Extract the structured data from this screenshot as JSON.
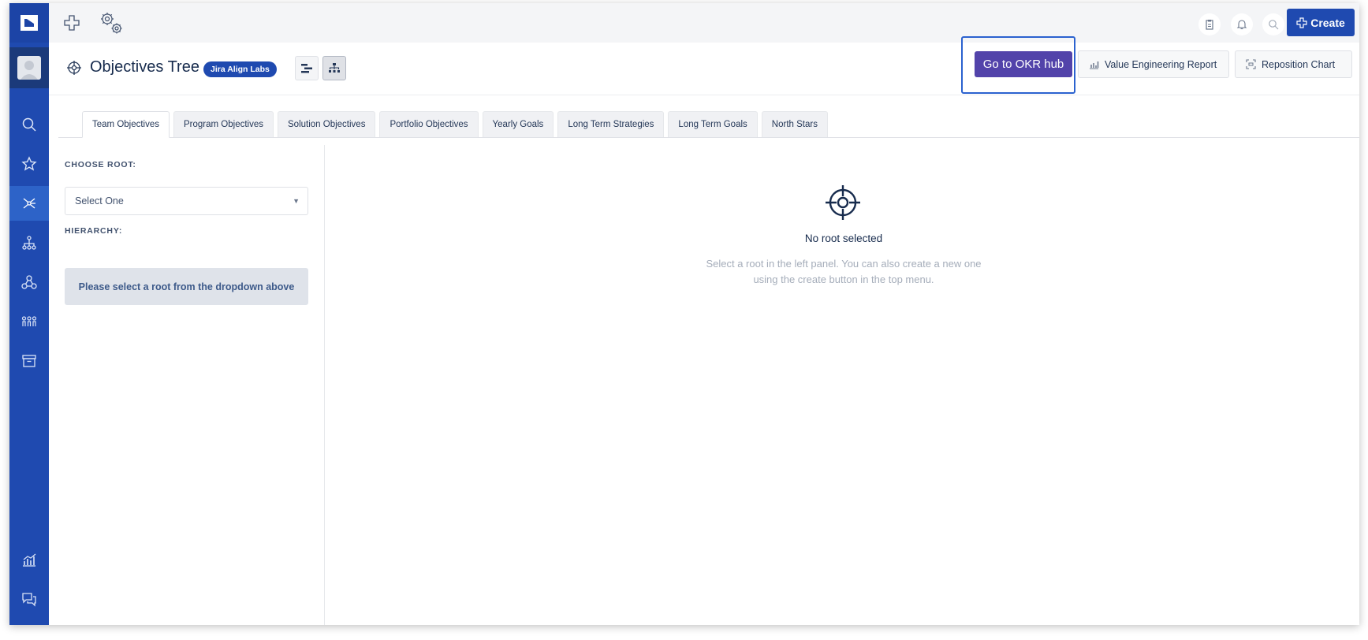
{
  "nav": {
    "items": [
      {
        "name": "search",
        "icon": "search-icon"
      },
      {
        "name": "favorites",
        "icon": "star-icon"
      },
      {
        "name": "objectives",
        "icon": "network-icon",
        "active": true
      },
      {
        "name": "hierarchy",
        "icon": "hierarchy-icon"
      },
      {
        "name": "teams",
        "icon": "connections-icon"
      },
      {
        "name": "people",
        "icon": "people-icon"
      },
      {
        "name": "archive",
        "icon": "archive-icon"
      },
      {
        "name": "reports",
        "icon": "chart-icon"
      },
      {
        "name": "feedback",
        "icon": "chat-icon"
      }
    ]
  },
  "topbar": {
    "create_label": "Create"
  },
  "header": {
    "title": "Objectives Tree",
    "badge": "Jira Align Labs",
    "okr_button": "Go to OKR hub",
    "value_report_button": "Value Engineering Report",
    "reposition_button": "Reposition Chart"
  },
  "tabs": [
    {
      "label": "Team Objectives",
      "active": true
    },
    {
      "label": "Program Objectives"
    },
    {
      "label": "Solution Objectives"
    },
    {
      "label": "Portfolio Objectives"
    },
    {
      "label": "Yearly Goals"
    },
    {
      "label": "Long Term Strategies"
    },
    {
      "label": "Long Term Goals"
    },
    {
      "label": "North Stars"
    }
  ],
  "left_panel": {
    "choose_root_label": "CHOOSE ROOT:",
    "select_value": "Select One",
    "hierarchy_label": "HIERARCHY:",
    "notice": "Please select a root from the dropdown above"
  },
  "empty_state": {
    "title": "No root selected",
    "description_line1": "Select a root in the left panel. You can also create a new one",
    "description_line2": "using the create button in the top menu."
  },
  "colors": {
    "nav_bg": "#1f4ab0",
    "nav_active": "#2d63c8",
    "okr_button": "#5243aa",
    "highlight": "#2b62cf"
  }
}
